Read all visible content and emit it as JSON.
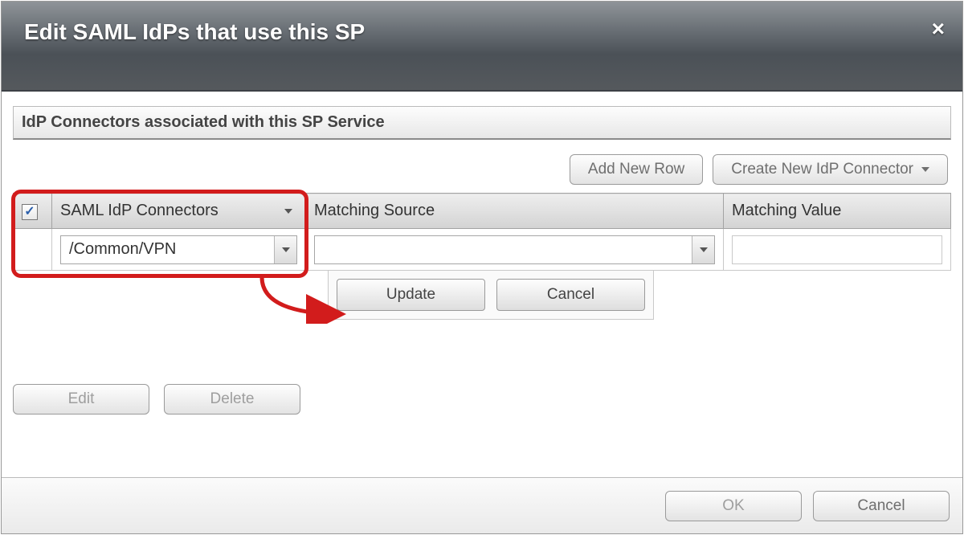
{
  "dialog": {
    "title": "Edit SAML IdPs that use this SP",
    "close_icon": "×"
  },
  "panel": {
    "title": "IdP Connectors associated with this SP Service"
  },
  "toolbar": {
    "add_row_label": "Add New Row",
    "create_connector_label": "Create New IdP Connector"
  },
  "grid": {
    "headers": {
      "connectors": "SAML IdP Connectors",
      "matching_source": "Matching Source",
      "matching_value": "Matching Value"
    },
    "row": {
      "checked": true,
      "connector_value": "/Common/VPN",
      "matching_source_value": "",
      "matching_value_value": ""
    }
  },
  "row_actions": {
    "update_label": "Update",
    "cancel_label": "Cancel"
  },
  "bottom": {
    "edit_label": "Edit",
    "delete_label": "Delete"
  },
  "footer": {
    "ok_label": "OK",
    "cancel_label": "Cancel"
  }
}
